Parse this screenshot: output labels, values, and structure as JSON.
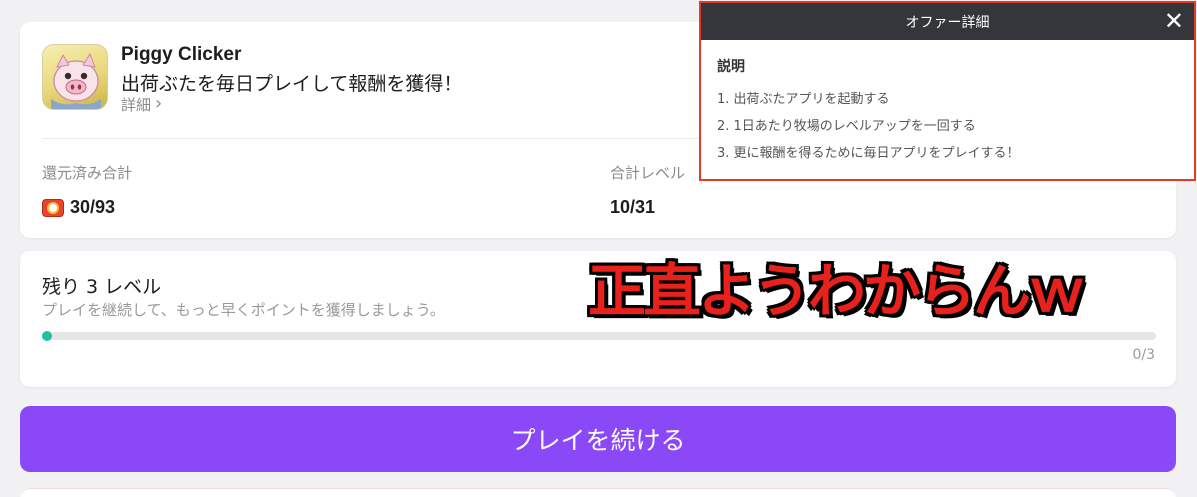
{
  "offer": {
    "app_name": "Piggy Clicker",
    "headline": "出荷ぶたを毎日プレイして報酬を獲得！",
    "details_link": "詳細",
    "icon": "piggy-app-icon"
  },
  "stats": {
    "returned_label": "還元済み合計",
    "returned_value": "30/93",
    "level_label": "合計レベル",
    "level_value": "10/31",
    "coin_icon": "point-coin-icon"
  },
  "progress": {
    "title": "残り 3 レベル",
    "subtitle": "プレイを継続して、もっと早くポイントを獲得しましょう。",
    "count": "0/3",
    "fraction": 0
  },
  "play_button": "プレイを続ける",
  "popup": {
    "title": "オファー詳細",
    "close": "✕",
    "section_title": "説明",
    "steps": [
      "1. 出荷ぶたアプリを起動する",
      "2. 1日あたり牧場のレベルアップを一回する",
      "3. 更に報酬を得るために毎日アプリをプレイする！"
    ]
  },
  "overlay_caption": "正直ようわからんｗ",
  "colors": {
    "accent": "#8a48f7",
    "progress_fill": "#20c0a0",
    "popup_border": "#e23b2a",
    "caption": "#e8211c"
  }
}
